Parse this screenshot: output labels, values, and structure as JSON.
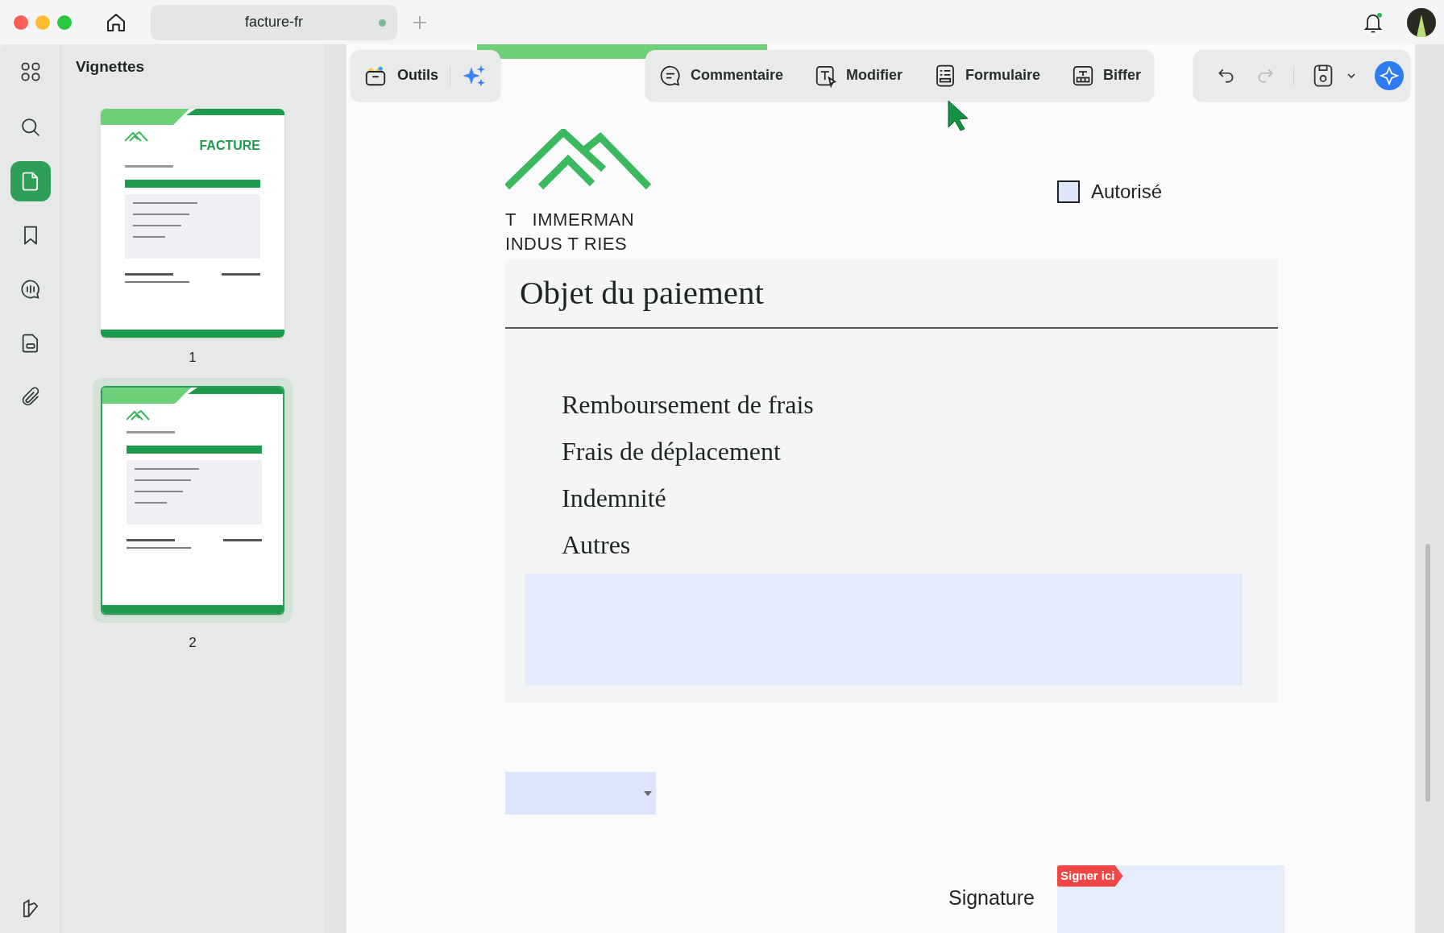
{
  "window": {
    "tab_title": "facture-fr",
    "tab_unsaved": true
  },
  "rail": [
    {
      "kind": "search",
      "selected": false
    },
    {
      "kind": "pages",
      "selected": true
    },
    {
      "kind": "bookmark",
      "selected": false
    },
    {
      "kind": "comment",
      "selected": false
    },
    {
      "kind": "form",
      "selected": false
    },
    {
      "kind": "attach",
      "selected": false
    }
  ],
  "sidebar": {
    "title": "Vignettes",
    "thumbnails": [
      {
        "page": "1",
        "heading": "FACTURE",
        "selected": false
      },
      {
        "page": "2",
        "selected": true
      }
    ]
  },
  "toolbar": {
    "tools_label": "Outils",
    "modes": [
      {
        "kind": "comment",
        "label": "Commentaire"
      },
      {
        "kind": "edit",
        "label": "Modifier"
      },
      {
        "kind": "form",
        "label": "Formulaire"
      },
      {
        "kind": "redact",
        "label": "Biffer"
      }
    ]
  },
  "document": {
    "company_lines": [
      "T   IMMERMAN",
      "INDUS T RIES"
    ],
    "checkbox": {
      "label": "Autorisé",
      "checked": false
    },
    "section_title": "Objet du paiement",
    "items": [
      "Remboursement de frais",
      "Frais de déplacement",
      "Indemnité",
      "Autres"
    ],
    "signature_label": "Signature",
    "sign_tag": "Signer ici"
  }
}
